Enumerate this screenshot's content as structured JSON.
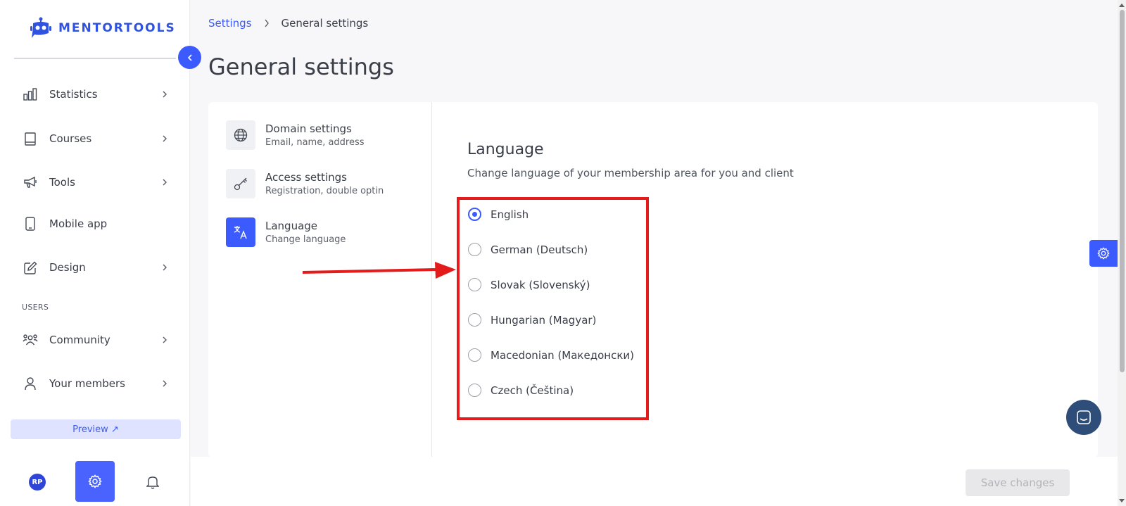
{
  "app": {
    "logo_text": "MENTORTOOLS"
  },
  "sidebar": {
    "items": [
      {
        "label": "Statistics",
        "icon": "bar-chart-icon"
      },
      {
        "label": "Courses",
        "icon": "book-icon"
      },
      {
        "label": "Tools",
        "icon": "megaphone-icon"
      },
      {
        "label": "Mobile app",
        "icon": "phone-icon"
      },
      {
        "label": "Design",
        "icon": "pencil-icon"
      }
    ],
    "section_users": "USERS",
    "user_items": [
      {
        "label": "Community",
        "icon": "community-icon"
      },
      {
        "label": "Your members",
        "icon": "user-icon"
      }
    ],
    "preview_label": "Preview ↗",
    "avatar_initials": "RP"
  },
  "breadcrumb": {
    "link": "Settings",
    "current": "General settings"
  },
  "page": {
    "title": "General settings"
  },
  "settings_menu": [
    {
      "title": "Domain settings",
      "subtitle": "Email, name, address",
      "icon": "globe-icon"
    },
    {
      "title": "Access settings",
      "subtitle": "Registration, double optin",
      "icon": "key-icon"
    },
    {
      "title": "Language",
      "subtitle": "Change language",
      "icon": "translate-icon"
    }
  ],
  "language": {
    "title": "Language",
    "description": "Change language of your membership area for you and client",
    "options": [
      "English",
      "German (Deutsch)",
      "Slovak (Slovenský)",
      "Hungarian (Magyar)",
      "Macedonian (Македонски)",
      "Czech (Čeština)"
    ],
    "selected": "English"
  },
  "footer": {
    "save_label": "Save changes"
  },
  "colors": {
    "accent": "#3b5bff",
    "highlight": "#e31b1b",
    "chat": "#2e4d78"
  }
}
